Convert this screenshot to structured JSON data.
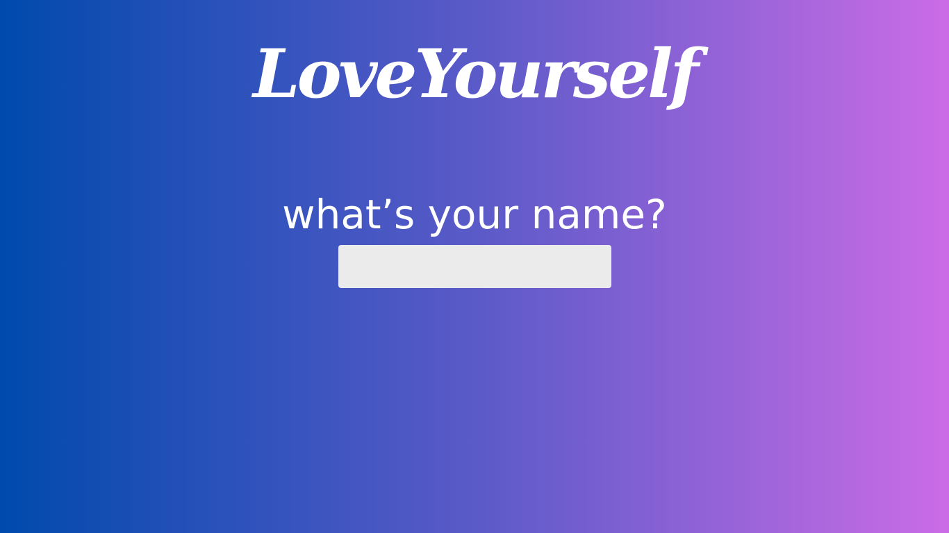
{
  "header": {
    "title": "LoveYourself"
  },
  "form": {
    "prompt": "what’s your name?",
    "name_input": {
      "value": "",
      "placeholder": ""
    }
  },
  "colors": {
    "gradient_start": "#004aad",
    "gradient_end": "#cb6ce6",
    "text": "#ffffff",
    "input_background": "#ebebeb"
  }
}
